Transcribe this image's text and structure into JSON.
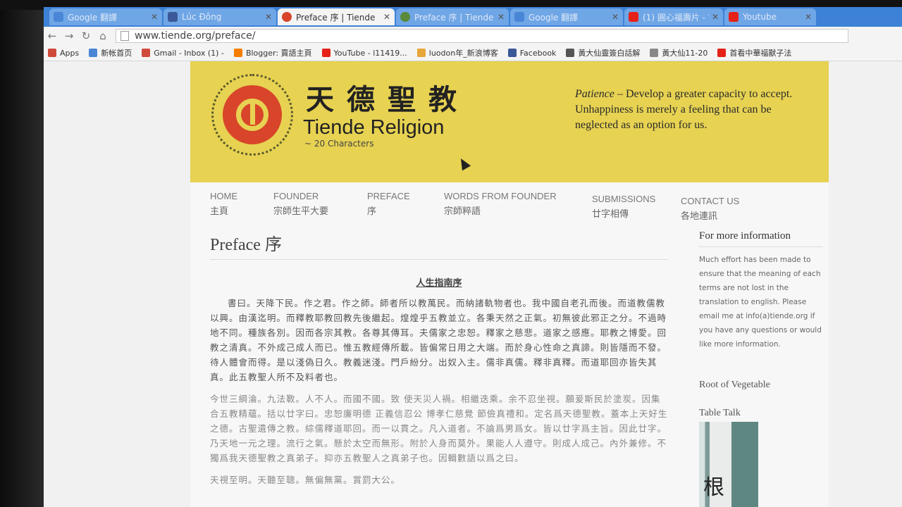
{
  "tabs": [
    {
      "label": "Google 翻譯",
      "favicon_color": "#4a86d6",
      "active": false
    },
    {
      "label": "Lúc Đông",
      "favicon_color": "#3b5998",
      "active": false
    },
    {
      "label": "Preface 序 | Tiende",
      "favicon_color": "#d8452a",
      "active": true
    },
    {
      "label": "Preface 序 | Tiende",
      "favicon_color": "#5a8a3a",
      "active": false
    },
    {
      "label": "Google 翻譯",
      "favicon_color": "#4a86d6",
      "active": false
    },
    {
      "label": "(1) 圓心福壽片 - Y",
      "favicon_color": "#e62117",
      "active": false
    },
    {
      "label": "Youtube",
      "favicon_color": "#e62117",
      "active": false
    }
  ],
  "toolbar": {
    "back_icon": "back-arrow-icon",
    "forward_icon": "forward-arrow-icon",
    "reload_icon": "reload-icon",
    "home_icon": "home-icon",
    "url": "www.tiende.org/preface/"
  },
  "bookmarks": [
    {
      "label": "Apps",
      "color": "#d04a3a"
    },
    {
      "label": "新帐首页",
      "color": "#4a86d6"
    },
    {
      "label": "Gmail - Inbox (1) -",
      "color": "#d04a3a"
    },
    {
      "label": "Blogger: 賣語主頁",
      "color": "#f57d00"
    },
    {
      "label": "YouTube - l11419...",
      "color": "#e62117"
    },
    {
      "label": "luodon年_新浪博客",
      "color": "#e8a53a"
    },
    {
      "label": "Facebook",
      "color": "#3b5998"
    },
    {
      "label": "黃大仙靈簽白話解",
      "color": "#555555"
    },
    {
      "label": "黃大仙11-20",
      "color": "#888888"
    },
    {
      "label": "首看中華福獸子法",
      "color": "#e62117"
    }
  ],
  "banner": {
    "title_cn": "天德聖教",
    "title_en": "Tiende Religion",
    "subtitle": "~ 20 Characters",
    "quote_term": "Patience",
    "quote_text": " – Develop a greater capacity to accept. Unhappiness is merely a feeling that can be neglected as an option for us.",
    "bg_color": "#e7d252",
    "logo_color": "#d8452a"
  },
  "nav": [
    {
      "en": "HOME",
      "cn": "主頁"
    },
    {
      "en": "FOUNDER",
      "cn": "宗師生平大要"
    },
    {
      "en": "PREFACE",
      "cn": "序"
    },
    {
      "en": "WORDS FROM FOUNDER",
      "cn": "宗師粹語"
    },
    {
      "en": "SUBMISSIONS",
      "cn": "廿字相傳"
    },
    {
      "en": "CONTACT US",
      "cn": "各地連訊"
    }
  ],
  "main": {
    "page_title": "Preface 序",
    "section_title": "人生指南序",
    "paragraphs": [
      "書曰。天降下民。作之君。作之師。師者所以教萬民。而納諸軌物者也。我中國自老孔而後。而道教儒教以興。由漢迄明。而釋教耶教回教先後繼起。煌煌乎五教並立。各秉天然之正氣。初無彼此邪正之分。不過時地不同。種族各別。因而各宗其教。各尊其傳耳。夫儒家之忠恕。釋家之慈悲。道家之感應。耶教之博愛。回教之清真。不外成己成人而已。惟五教經傳所載。皆偏常日用之大端。而於身心性命之真諦。則皆隱而不發。待人體會而得。是以淺偽日久。教義迷淺。門戶紛分。出奴入主。儒非真儒。釋非真釋。而道耶回亦皆失其真。此五教聖人所不及料者也。",
      "今世三綱淪。九法斁。人不人。而國不國。致 使天災人禍。相繼迭乘。余不忍坐視。願爰斯民於塗炭。因集合五教精蘊。括以廿字曰。忠恕廉明德 正義信忍公 博孝仁慈覺 節儉真禮和。定名爲天德聖教。蓋本上天好生之德。古聖遺傳之教。綜儒釋道耶回。而一以貫之。凡入道者。不論爲男爲女。皆以廿字爲主旨。因此廿字。乃天地一元之理。流行之氣。懸於太空而無形。附於人身而莫外。果能人人遵守。則成人成己。內外兼修。不獨爲我天德聖教之真弟子。抑亦五教聖人之真弟子也。因輯數語以爲之曰。",
      "天視至明。天聽至聰。無偏無黨。賞罰大公。"
    ]
  },
  "sidebar": {
    "info_heading": "For more information",
    "info_text": "Much effort has been made to ensure that the meaning of each terms are not lost in the translation to english. Please email me at info(a)tiende.org if you have any questions or would like more information.",
    "heading2": "Root of Vegetable",
    "heading3": "Table Talk",
    "book_glyph": "根"
  }
}
